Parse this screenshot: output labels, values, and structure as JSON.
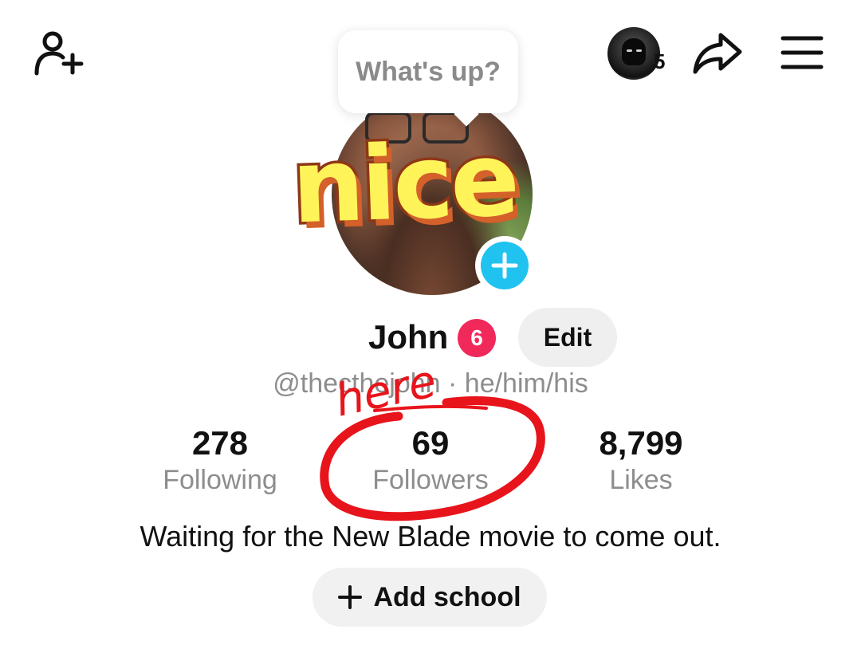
{
  "header": {
    "story_count": "5"
  },
  "avatar": {
    "bubble_text": "What's up?",
    "sticker_text": "nice"
  },
  "profile": {
    "name": "John",
    "name_badge": "6",
    "edit_label": "Edit",
    "handle_line": "@thecthejohn · he/him/his"
  },
  "stats": [
    {
      "value": "278",
      "label": "Following"
    },
    {
      "value": "69",
      "label": "Followers"
    },
    {
      "value": "8,799",
      "label": "Likes"
    }
  ],
  "bio": "Waiting for the New Blade movie to come out.",
  "school": {
    "label": "Add school"
  },
  "annotation": {
    "text": "here"
  },
  "colors": {
    "accent_pink": "#f0295a",
    "add_story_blue": "#20c3f0",
    "annotation_red": "#e8141b",
    "muted_text": "#8d8d8d"
  },
  "icons": {
    "top_left": "add-friend-icon",
    "share": "share-arrow-icon",
    "menu": "hamburger-menu-icon",
    "add_story": "plus-icon",
    "add_school": "plus-icon"
  }
}
